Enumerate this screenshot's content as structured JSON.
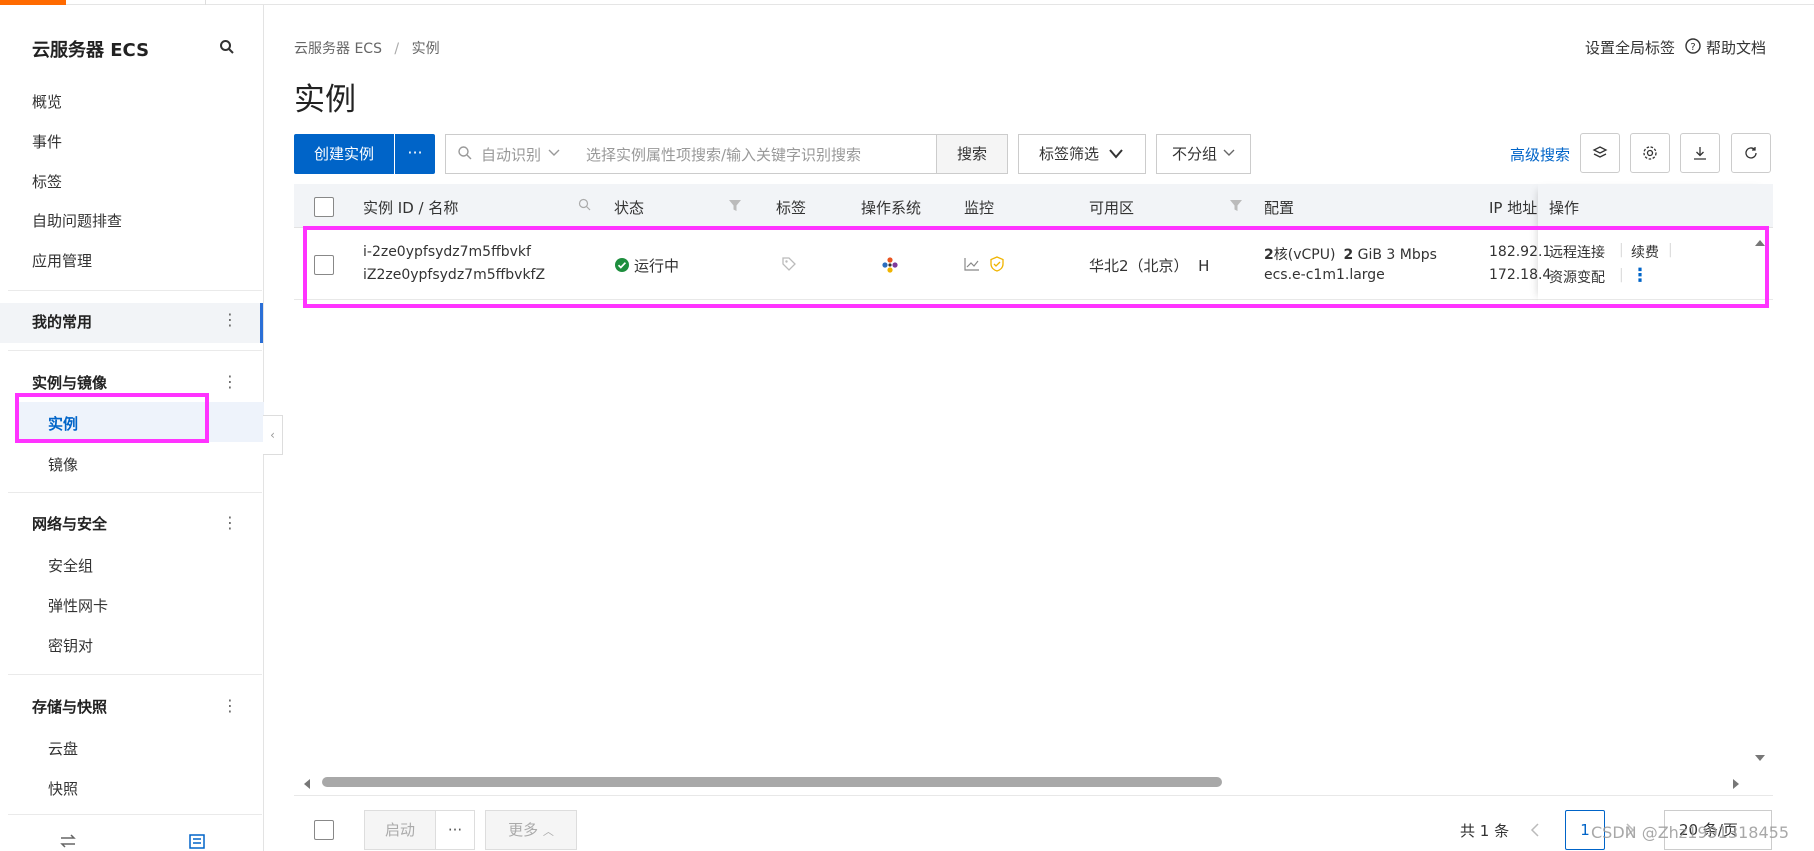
{
  "sidebar": {
    "title": "云服务器 ECS",
    "top_items": [
      "概览",
      "事件",
      "标签",
      "自助问题排查",
      "应用管理"
    ],
    "favorites": "我的常用",
    "groups": {
      "instances": {
        "label": "实例与镜像",
        "items": [
          "实例",
          "镜像"
        ]
      },
      "network": {
        "label": "网络与安全",
        "items": [
          "安全组",
          "弹性网卡",
          "密钥对"
        ]
      },
      "storage": {
        "label": "存储与快照",
        "items": [
          "云盘",
          "快照"
        ]
      }
    }
  },
  "header": {
    "breadcrumb_root": "云服务器 ECS",
    "breadcrumb_sep": "/",
    "breadcrumb_current": "实例",
    "page_title": "实例",
    "global_tags": "设置全局标签",
    "help_docs": "帮助文档"
  },
  "toolbar": {
    "create_label": "创建实例",
    "more_label": "···",
    "search_mode": "自动识别",
    "search_placeholder": "选择实例属性项搜索/输入关键字识别搜索",
    "search_button": "搜索",
    "tag_filter": "标签筛选",
    "group_by": "不分组",
    "advanced_search": "高级搜索"
  },
  "table": {
    "columns": {
      "id": "实例 ID / 名称",
      "status": "状态",
      "tag": "标签",
      "os": "操作系统",
      "monitor": "监控",
      "zone": "可用区",
      "config": "配置",
      "ip": "IP 地址",
      "actions": "操作"
    },
    "rows": [
      {
        "id": "i-2ze0ypfsydz7m5ffbvkf",
        "name": "iZ2ze0ypfsydz7m5ffbvkfZ",
        "status": "运行中",
        "zone": "华北2（北京）  H",
        "cpu_num": "2",
        "cpu_unit": "核(vCPU)",
        "mem_num": "2",
        "mem_rest": "GiB 3 Mbps",
        "instance_type": "ecs.e-c1m1.large",
        "ip_public": "182.92.1",
        "ip_private": "172.18.4",
        "action_remote": "远程连接",
        "action_renew": "续费",
        "action_change": "资源变配"
      }
    ]
  },
  "footer": {
    "start_label": "启动",
    "more_dots": "···",
    "more_label": "更多",
    "total": "共 1 条",
    "current_page": "1",
    "page_size": "20 条/页"
  },
  "watermark": "CSDN @Zhz1991318455",
  "colors": {
    "primary": "#0064c8",
    "highlight": "#ff33ff",
    "accent": "#ff6a00",
    "running": "#1e8e3e"
  }
}
